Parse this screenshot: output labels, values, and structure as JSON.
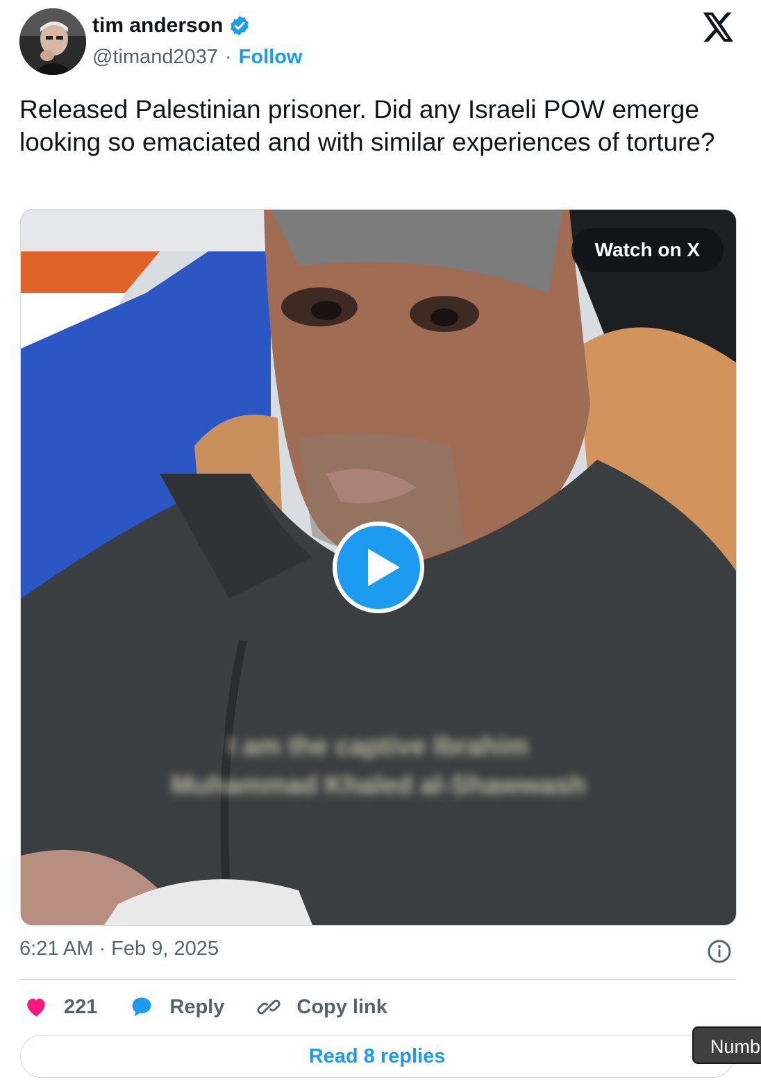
{
  "author": {
    "display_name": "tim anderson",
    "handle": "@timand2037",
    "separator": "·",
    "follow_label": "Follow"
  },
  "tweet": {
    "text": "Released Palestinian prisoner. Did any Israeli POW emerge looking so emaciated and with similar experiences of torture?"
  },
  "media": {
    "watch_label": "Watch on X",
    "caption_line1": "I am the captive Ibrahim",
    "caption_line2": "Muhammad Khaled al-Shawwash"
  },
  "meta": {
    "timestamp": "6:21 AM · Feb 9, 2025"
  },
  "actions": {
    "like_count": "221",
    "reply_label": "Reply",
    "copy_label": "Copy link"
  },
  "footer": {
    "read_replies_label": "Read 8 replies",
    "tooltip_text": "Numb"
  },
  "colors": {
    "accent": "#1d9bf0",
    "like": "#f91880",
    "secondary_text": "#536471"
  }
}
